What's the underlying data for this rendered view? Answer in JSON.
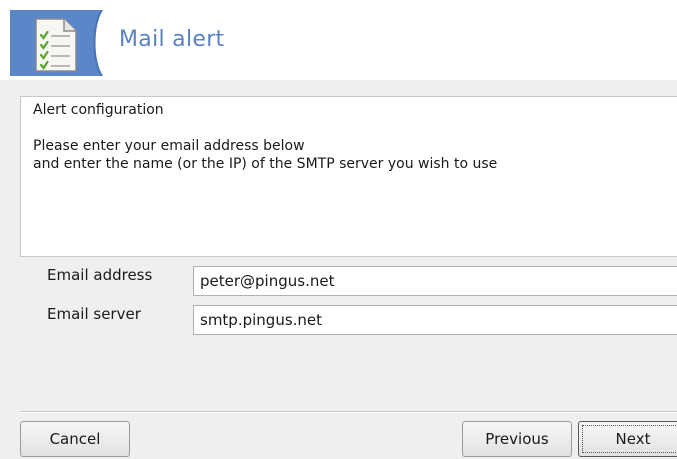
{
  "header": {
    "title": "Mail alert",
    "icon": "checklist-document-icon",
    "accent_color": "#5b86c8",
    "title_color": "#5a82c0"
  },
  "info": {
    "title": "Alert configuration",
    "description_line1": "Please enter your email address below",
    "description_line2": "and enter the name (or the IP) of the SMTP server you wish to use"
  },
  "form": {
    "email_address": {
      "label": "Email address",
      "value": "peter@pingus.net"
    },
    "email_server": {
      "label": "Email server",
      "value": "smtp.pingus.net"
    }
  },
  "buttons": {
    "cancel": "Cancel",
    "previous": "Previous",
    "next": "Next"
  }
}
